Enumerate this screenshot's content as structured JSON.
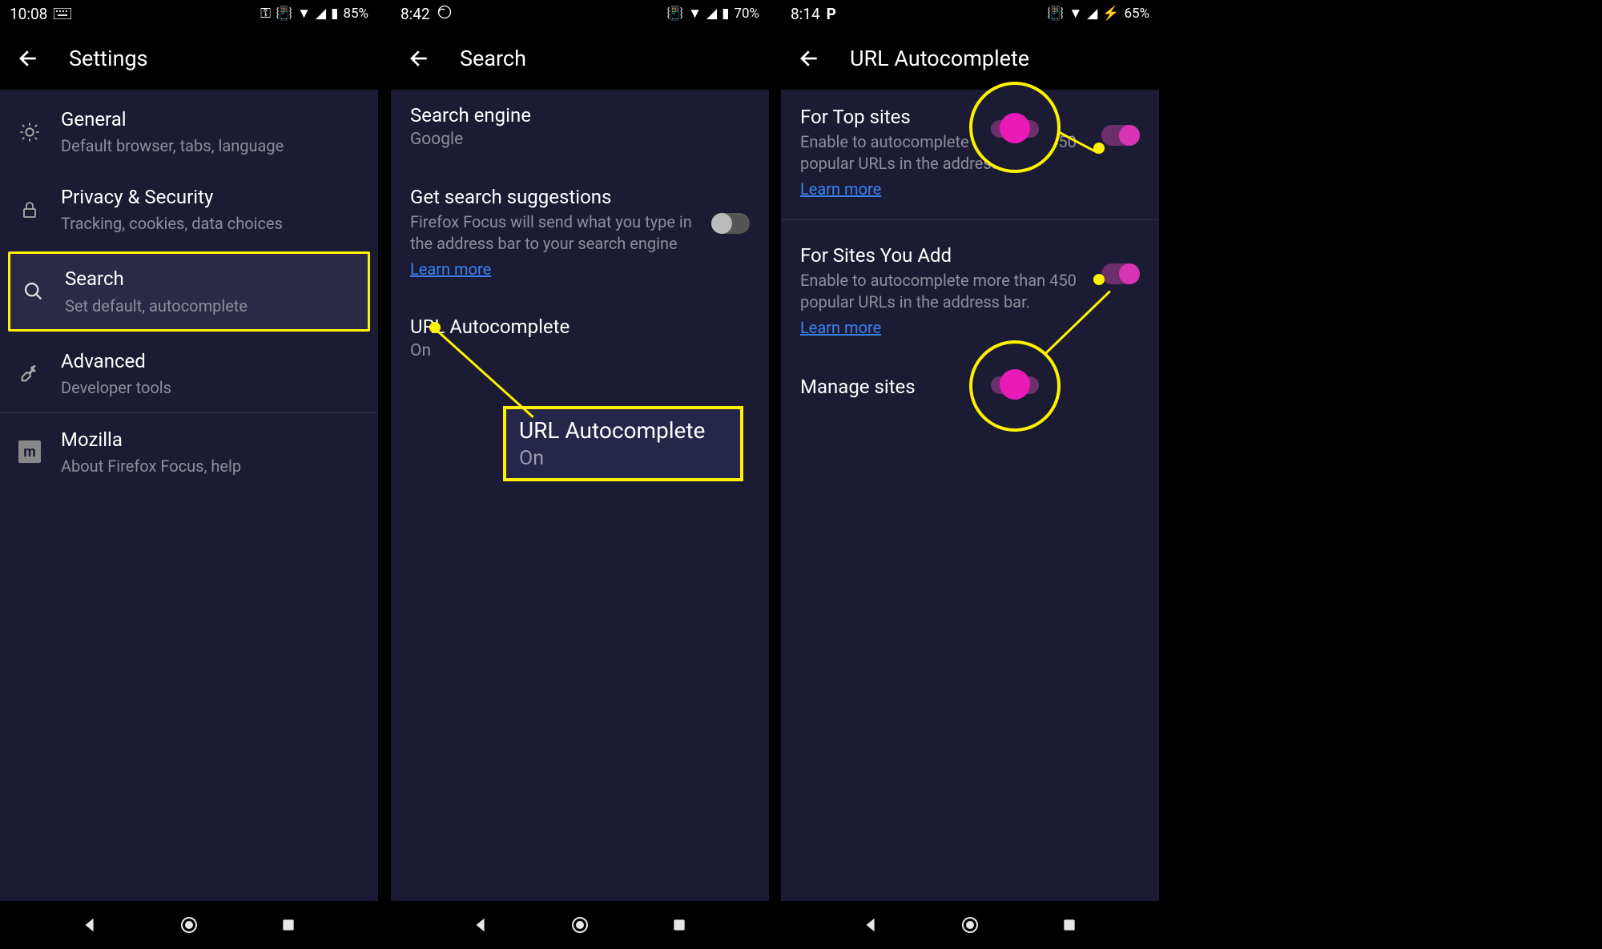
{
  "screen1": {
    "status": {
      "time": "10:08",
      "battery": "85%"
    },
    "app_title": "Settings",
    "items": [
      {
        "title": "General",
        "sub": "Default browser, tabs, language"
      },
      {
        "title": "Privacy & Security",
        "sub": "Tracking, cookies, data choices"
      },
      {
        "title": "Search",
        "sub": "Set default, autocomplete"
      },
      {
        "title": "Advanced",
        "sub": "Developer tools"
      },
      {
        "title": "Mozilla",
        "sub": "About Firefox Focus, help"
      }
    ]
  },
  "screen2": {
    "status": {
      "time": "8:42",
      "battery": "70%"
    },
    "app_title": "Search",
    "engine": {
      "title": "Search engine",
      "value": "Google"
    },
    "suggestions": {
      "title": "Get search suggestions",
      "desc": "Firefox Focus will send what you type in the address bar to your search engine",
      "learn": "Learn more"
    },
    "autocomplete": {
      "title": "URL Autocomplete",
      "value": "On"
    },
    "callout": {
      "title": "URL Autocomplete",
      "value": "On"
    }
  },
  "screen3": {
    "status": {
      "time": "8:14",
      "battery": "65%"
    },
    "app_title": "URL Autocomplete",
    "top": {
      "title": "For Top sites",
      "desc": "Enable to autocomplete more than 450 popular URLs in the address bar.",
      "learn": "Learn more"
    },
    "add": {
      "title": "For Sites You Add",
      "desc": "Enable to autocomplete more than 450 popular URLs in the address bar.",
      "learn": "Learn more"
    },
    "manage": "Manage sites"
  }
}
